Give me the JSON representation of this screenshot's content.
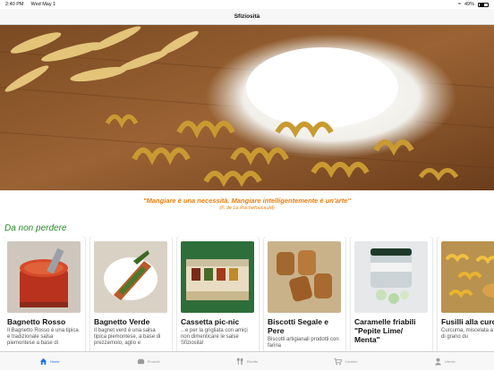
{
  "status": {
    "time": "2:40 PM",
    "date": "Wed May 1",
    "battery": "49%"
  },
  "nav": {
    "title": "Sfiziosità"
  },
  "quote": {
    "text": "\"Mangiare è una necessità. Mangiare intelligentemente è un'arte\"",
    "author": "(F. de La Rochefoucauld)"
  },
  "section": {
    "title": "Da non perdere"
  },
  "cards": [
    {
      "title": "Bagnetto Rosso",
      "desc": "Il Bagnetto Rosso è una tipica e tradizionale salsa piemontese a base di"
    },
    {
      "title": "Bagnetto Verde",
      "desc": "Il bagnet verd è una salsa tipica piemontese, a base di prezzemolo, aglio e"
    },
    {
      "title": "Cassetta pic-nic",
      "desc": "...e per la grigliata con amici non dimenticare le salse Sfiziosità!"
    },
    {
      "title": "Biscotti Segale e Pere",
      "desc": "Biscotti artigianali prodotti con farina"
    },
    {
      "title": "Caramelle friabili \"Pepite Lime/ Menta\"",
      "desc": ""
    },
    {
      "title": "Fusilli alla curcuma",
      "desc": "Curcuma, miscelata a semola di grano du"
    }
  ],
  "tabs": [
    {
      "label": "Home",
      "icon": "home-icon"
    },
    {
      "label": "Prodotti",
      "icon": "products-icon"
    },
    {
      "label": "Ricette",
      "icon": "recipes-icon"
    },
    {
      "label": "Carrello",
      "icon": "cart-icon"
    },
    {
      "label": "Utente",
      "icon": "user-icon"
    }
  ],
  "colors": {
    "accent": "#1a73e8",
    "quote": "#e87e10",
    "section": "#2a8a2a"
  }
}
